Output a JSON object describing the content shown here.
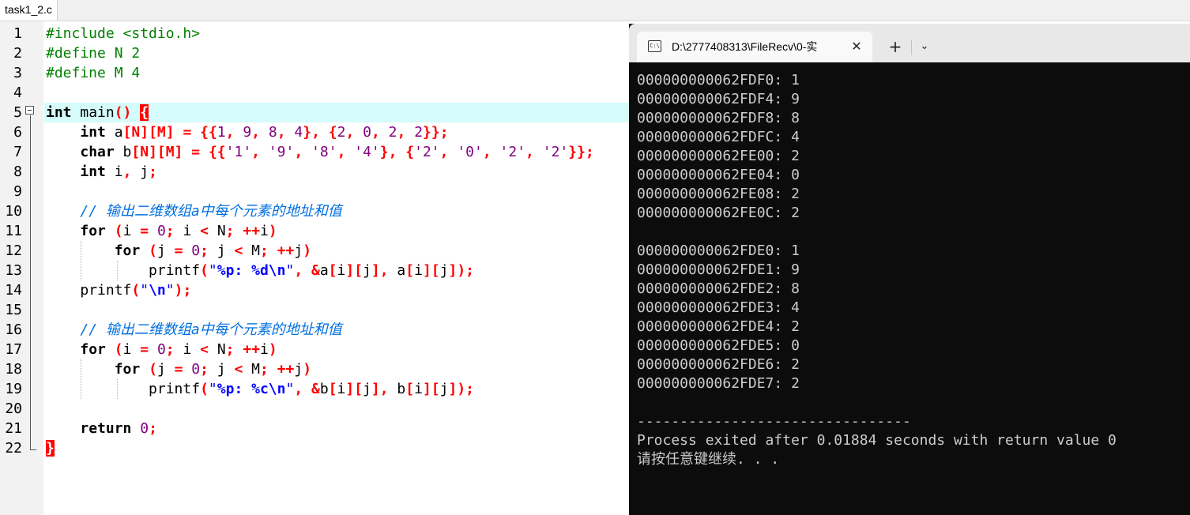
{
  "editor": {
    "tab_label": "task1_2.c",
    "line_numbers": [
      "1",
      "2",
      "3",
      "4",
      "5",
      "6",
      "7",
      "8",
      "9",
      "10",
      "11",
      "12",
      "13",
      "14",
      "15",
      "16",
      "17",
      "18",
      "19",
      "20",
      "21",
      "22"
    ],
    "code": {
      "l1": "#include <stdio.h>",
      "l2": "#define N 2",
      "l3": "#define M 4",
      "l5_kw": "int",
      "l5_rest": " main",
      "l5_paren": "()",
      "l5_brace": "{",
      "l6_kw": "int",
      "l6_a": " a",
      "l6_idx": "[N][M]",
      "l7_kw": "char",
      "l7_b": " b",
      "l7_idx": "[N][M]",
      "l8_kw": "int",
      "l8_rest": " i",
      "l8_j": " j",
      "comment": "// 输出二维数组a中每个元素的地址和值",
      "for_kw": "for",
      "return_kw": "return",
      "printf_fn": "printf",
      "l13_fmt": "%p: %d\\n",
      "l19_fmt": "%p: %c\\n",
      "l14_fmt": "\\n",
      "close_brace": "}"
    }
  },
  "terminal": {
    "title": "D:\\2777408313\\FileRecv\\0-实",
    "icon": "cmd-icon",
    "close_label": "✕",
    "new_tab_label": "+",
    "dropdown_label": "⌄",
    "output_int": [
      "000000000062FDF0: 1",
      "000000000062FDF4: 9",
      "000000000062FDF8: 8",
      "000000000062FDFC: 4",
      "000000000062FE00: 2",
      "000000000062FE04: 0",
      "000000000062FE08: 2",
      "000000000062FE0C: 2"
    ],
    "output_char": [
      "000000000062FDE0: 1",
      "000000000062FDE1: 9",
      "000000000062FDE2: 8",
      "000000000062FDE3: 4",
      "000000000062FDE4: 2",
      "000000000062FDE5: 0",
      "000000000062FDE6: 2",
      "000000000062FDE7: 2"
    ],
    "divider": "--------------------------------",
    "exit_message": "Process exited after 0.01884 seconds with return value 0",
    "continue_prompt": "请按任意键继续. . ."
  }
}
